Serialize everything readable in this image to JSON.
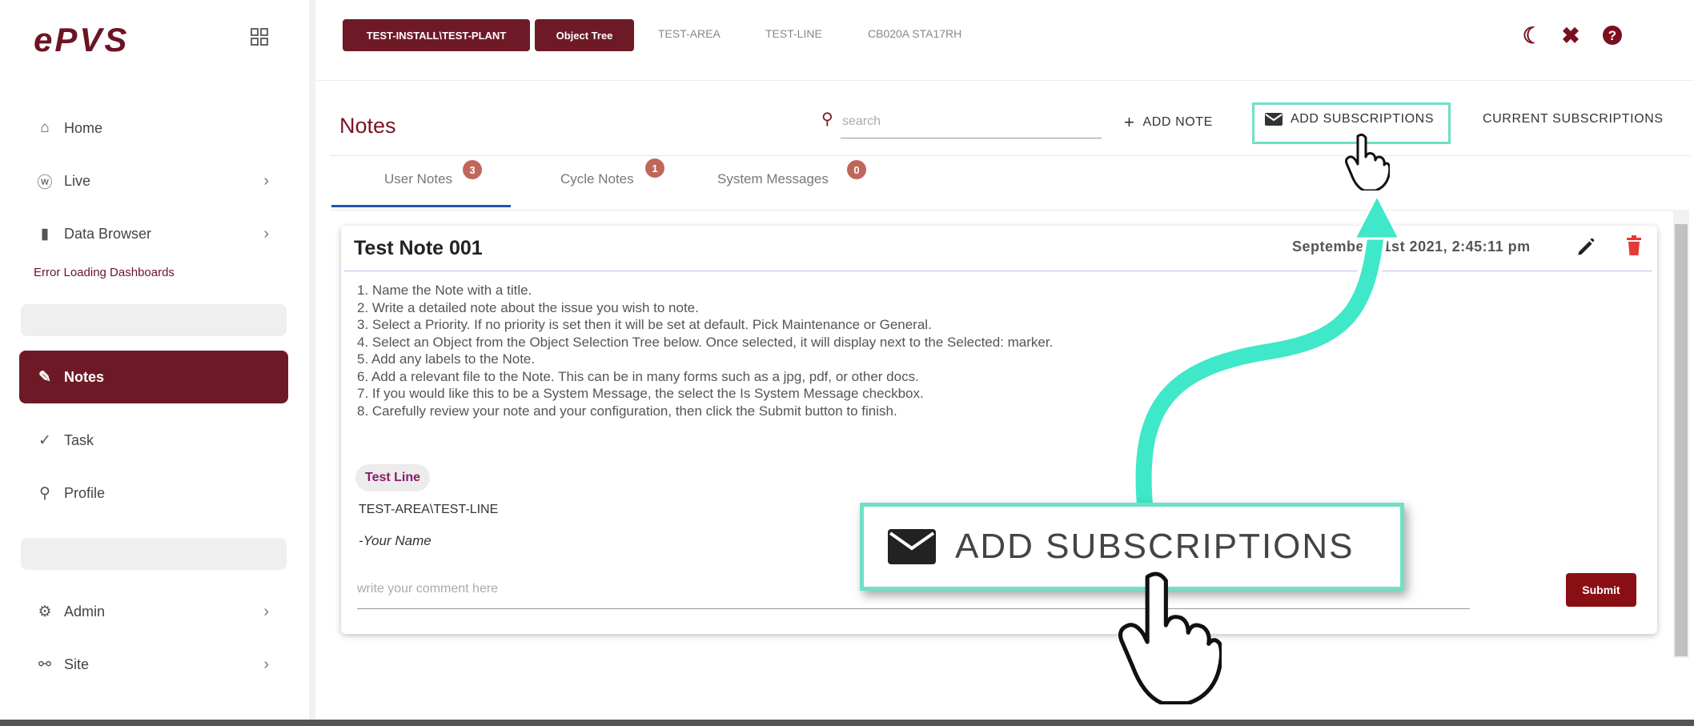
{
  "app": {
    "logo": "ePVS"
  },
  "sidebar": {
    "items": [
      {
        "label": "Home",
        "icon": "home-icon"
      },
      {
        "label": "Live",
        "icon": "wifi-icon"
      },
      {
        "label": "Data Browser",
        "icon": "bar-chart-icon"
      },
      {
        "label": "Notes",
        "icon": "edit-icon"
      },
      {
        "label": "Task",
        "icon": "check-circle-icon"
      },
      {
        "label": "Profile",
        "icon": "user-icon"
      },
      {
        "label": "Admin",
        "icon": "gear-icon"
      },
      {
        "label": "Site",
        "icon": "share-icon"
      }
    ],
    "error_text": "Error Loading Dashboards"
  },
  "topbar": {
    "crumbs": [
      "TEST-INSTALL\\TEST-PLANT",
      "Object Tree",
      "TEST-AREA",
      "TEST-LINE",
      "CB020A STA17RH"
    ],
    "accent": "#6e1a26"
  },
  "notes": {
    "title": "Notes",
    "search_placeholder": "search",
    "add_note": "ADD NOTE",
    "add_subscriptions": "ADD SUBSCRIPTIONS",
    "current_subscriptions": "CURRENT SUBSCRIPTIONS",
    "tabs": [
      {
        "label": "User Notes",
        "count": "3"
      },
      {
        "label": "Cycle Notes",
        "count": "1"
      },
      {
        "label": "System Messages",
        "count": "0"
      }
    ]
  },
  "note": {
    "title": "Test Note 001",
    "date": "September 21st 2021, 2:45:11 pm",
    "lines": [
      "1. Name the Note with a title.",
      "2. Write a detailed note about the issue you wish to note.",
      "3. Select a Priority. If no priority is set then it will be set at default. Pick Maintenance or General.",
      "4. Select an Object from the Object Selection Tree below. Once selected, it will display next to the Selected: marker.",
      "5. Add any labels to the Note.",
      "6. Add a relevant file to the Note. This can be in many forms such as a jpg, pdf, or other docs.",
      "7. If you would like this to be a System Message, the select the Is System Message checkbox.",
      "8. Carefully review your note and your configuration, then click the Submit button to finish."
    ],
    "label": "Test Line",
    "object_path": "TEST-AREA\\TEST-LINE",
    "signature": "-Your Name",
    "comment_placeholder": "write your comment here",
    "submit": "Submit"
  },
  "callout": {
    "label": "ADD SUBSCRIPTIONS",
    "highlight": "#6ee0c6"
  }
}
